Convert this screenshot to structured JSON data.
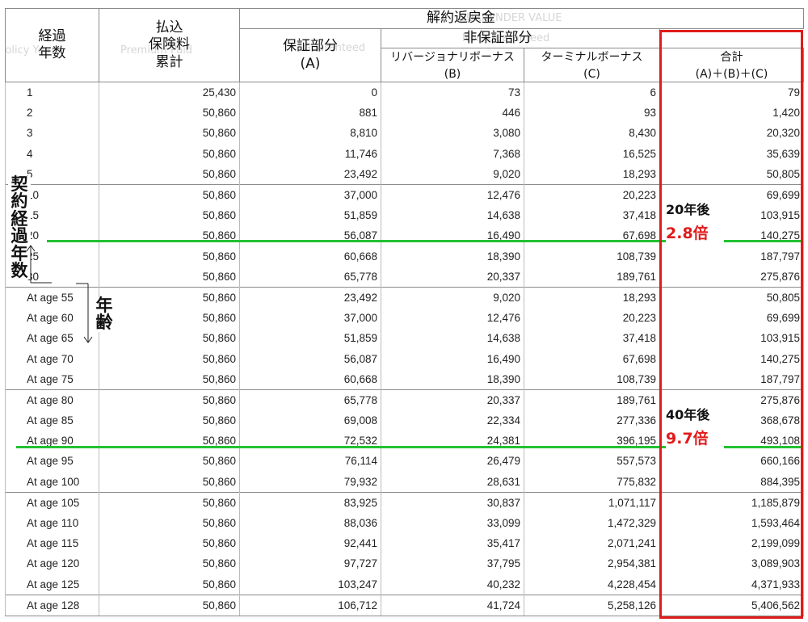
{
  "header": {
    "col0": {
      "text": "経過\n年数",
      "ghost": "Policy Year"
    },
    "col1": {
      "text": "払込\n保険料\n累計",
      "ghost": "Premium Paid"
    },
    "surrender": {
      "text": "解約返戻金",
      "ghost": "SURRENDER VALUE"
    },
    "guaranteed": {
      "text": "保証部分\n(A)",
      "ghost": "Guaranteed"
    },
    "non_guaranteed": {
      "text": "非保証部分",
      "ghost": "Non-Guaranteed"
    },
    "reversionary": {
      "text": "リバージョナリボーナス\n(B)"
    },
    "terminal": {
      "text": "ターミナルボーナス\n(C)"
    },
    "total": {
      "text": "合計\n(A)＋(B)＋(C)"
    }
  },
  "rows": [
    [
      "1",
      "25,430",
      "0",
      "73",
      "6",
      "79"
    ],
    [
      "2",
      "50,860",
      "881",
      "446",
      "93",
      "1,420"
    ],
    [
      "3",
      "50,860",
      "8,810",
      "3,080",
      "8,430",
      "20,320"
    ],
    [
      "4",
      "50,860",
      "11,746",
      "7,368",
      "16,525",
      "35,639"
    ],
    [
      "5",
      "50,860",
      "23,492",
      "9,020",
      "18,293",
      "50,805"
    ],
    [
      "10",
      "50,860",
      "37,000",
      "12,476",
      "20,223",
      "69,699"
    ],
    [
      "15",
      "50,860",
      "51,859",
      "14,638",
      "37,418",
      "103,915"
    ],
    [
      "20",
      "50,860",
      "56,087",
      "16,490",
      "67,698",
      "140,275"
    ],
    [
      "25",
      "50,860",
      "60,668",
      "18,390",
      "108,739",
      "187,797"
    ],
    [
      "30",
      "50,860",
      "65,778",
      "20,337",
      "189,761",
      "275,876"
    ],
    [
      "At age 55",
      "50,860",
      "23,492",
      "9,020",
      "18,293",
      "50,805"
    ],
    [
      "At age 60",
      "50,860",
      "37,000",
      "12,476",
      "20,223",
      "69,699"
    ],
    [
      "At age 65",
      "50,860",
      "51,859",
      "14,638",
      "37,418",
      "103,915"
    ],
    [
      "At age 70",
      "50,860",
      "56,087",
      "16,490",
      "67,698",
      "140,275"
    ],
    [
      "At age 75",
      "50,860",
      "60,668",
      "18,390",
      "108,739",
      "187,797"
    ],
    [
      "At age 80",
      "50,860",
      "65,778",
      "20,337",
      "189,761",
      "275,876"
    ],
    [
      "At age 85",
      "50,860",
      "69,008",
      "22,334",
      "277,336",
      "368,678"
    ],
    [
      "At age 90",
      "50,860",
      "72,532",
      "24,381",
      "396,195",
      "493,108"
    ],
    [
      "At age 95",
      "50,860",
      "76,114",
      "26,479",
      "557,573",
      "660,166"
    ],
    [
      "At age 100",
      "50,860",
      "79,932",
      "28,631",
      "775,832",
      "884,395"
    ],
    [
      "At age 105",
      "50,860",
      "83,925",
      "30,837",
      "1,071,117",
      "1,185,879"
    ],
    [
      "At age 110",
      "50,860",
      "88,036",
      "33,099",
      "1,472,329",
      "1,593,464"
    ],
    [
      "At age 115",
      "50,860",
      "92,441",
      "35,417",
      "2,071,241",
      "2,199,099"
    ],
    [
      "At age 120",
      "50,860",
      "97,727",
      "37,795",
      "2,954,381",
      "3,089,903"
    ],
    [
      "At age 125",
      "50,860",
      "103,247",
      "40,232",
      "4,228,454",
      "4,371,933"
    ],
    [
      "At age 128",
      "50,860",
      "106,712",
      "41,724",
      "5,258,126",
      "5,406,562"
    ]
  ],
  "annotations": {
    "contract_years_label": "契約経過年数",
    "age_label": "年齢",
    "note20": {
      "line1": "20年後",
      "line2": "2.8倍"
    },
    "note40": {
      "line1": "40年後",
      "line2": "9.7倍"
    },
    "highlight_color": "#e01b1b",
    "line_color": "#22c232"
  }
}
